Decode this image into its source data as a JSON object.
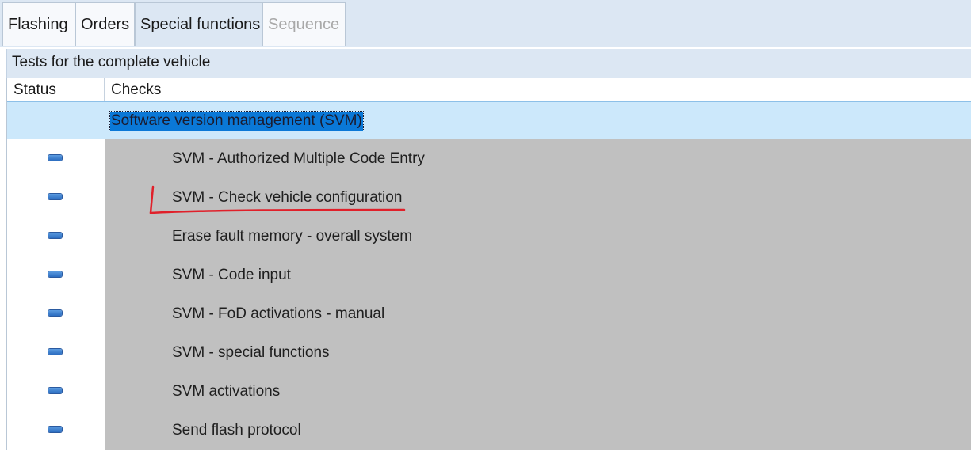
{
  "tabs": [
    {
      "label": "Flashing",
      "state": "normal"
    },
    {
      "label": "Orders",
      "state": "normal"
    },
    {
      "label": "Special functions",
      "state": "active"
    },
    {
      "label": "Sequence",
      "state": "disabled"
    }
  ],
  "section": {
    "title": "Tests for the complete vehicle"
  },
  "table": {
    "columns": {
      "status": "Status",
      "checks": "Checks"
    },
    "group": {
      "label": "Software version management  (SVM)",
      "selected": true
    },
    "rows": [
      {
        "label": "SVM - Authorized Multiple Code Entry",
        "status_icon": "status-pending-icon"
      },
      {
        "label": "SVM - Check vehicle configuration",
        "status_icon": "status-pending-icon",
        "annotated": true
      },
      {
        "label": "Erase fault memory - overall system",
        "status_icon": "status-pending-icon"
      },
      {
        "label": "SVM - Code input",
        "status_icon": "status-pending-icon"
      },
      {
        "label": "SVM - FoD activations - manual",
        "status_icon": "status-pending-icon"
      },
      {
        "label": "SVM - special functions",
        "status_icon": "status-pending-icon"
      },
      {
        "label": "SVM activations",
        "status_icon": "status-pending-icon"
      },
      {
        "label": "Send flash protocol",
        "status_icon": "status-pending-icon"
      }
    ]
  },
  "colors": {
    "tabstrip_bg": "#dce7f3",
    "selection_bg": "#cce8fb",
    "selection_text_bg": "#0a78d7",
    "row_bg": "#c0c0c0",
    "status_icon": "#3b7fd0",
    "annotation": "#e0202a"
  }
}
